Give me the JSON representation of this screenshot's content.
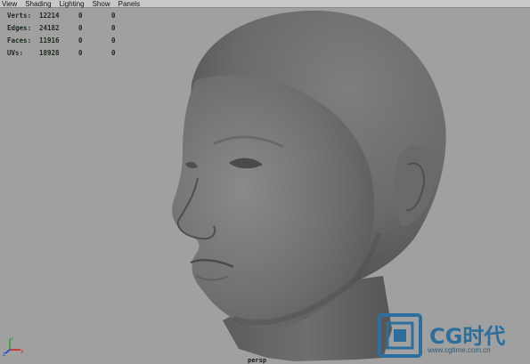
{
  "menu": [
    "View",
    "Shading",
    "Lighting",
    "Show",
    "Panels"
  ],
  "hud": {
    "rows": [
      {
        "label": "Verts:",
        "v1": "12214",
        "v2": "0",
        "v3": "0"
      },
      {
        "label": "Edges:",
        "v1": "24182",
        "v2": "0",
        "v3": "0"
      },
      {
        "label": "Faces:",
        "v1": "11916",
        "v2": "0",
        "v3": "0"
      },
      {
        "label": "UVs:",
        "v1": "18928",
        "v2": "0",
        "v3": "0"
      }
    ]
  },
  "camera": "persp",
  "axes": {
    "x": "X",
    "y": "Y",
    "z": "Z"
  },
  "watermark": {
    "text": "CG时代",
    "url": "www.cgtime.com.cn"
  },
  "colors": {
    "background": "#a0a0a0",
    "menubar": "#c8c8c8",
    "model": "#707070",
    "brand": "#2c6f9c"
  }
}
